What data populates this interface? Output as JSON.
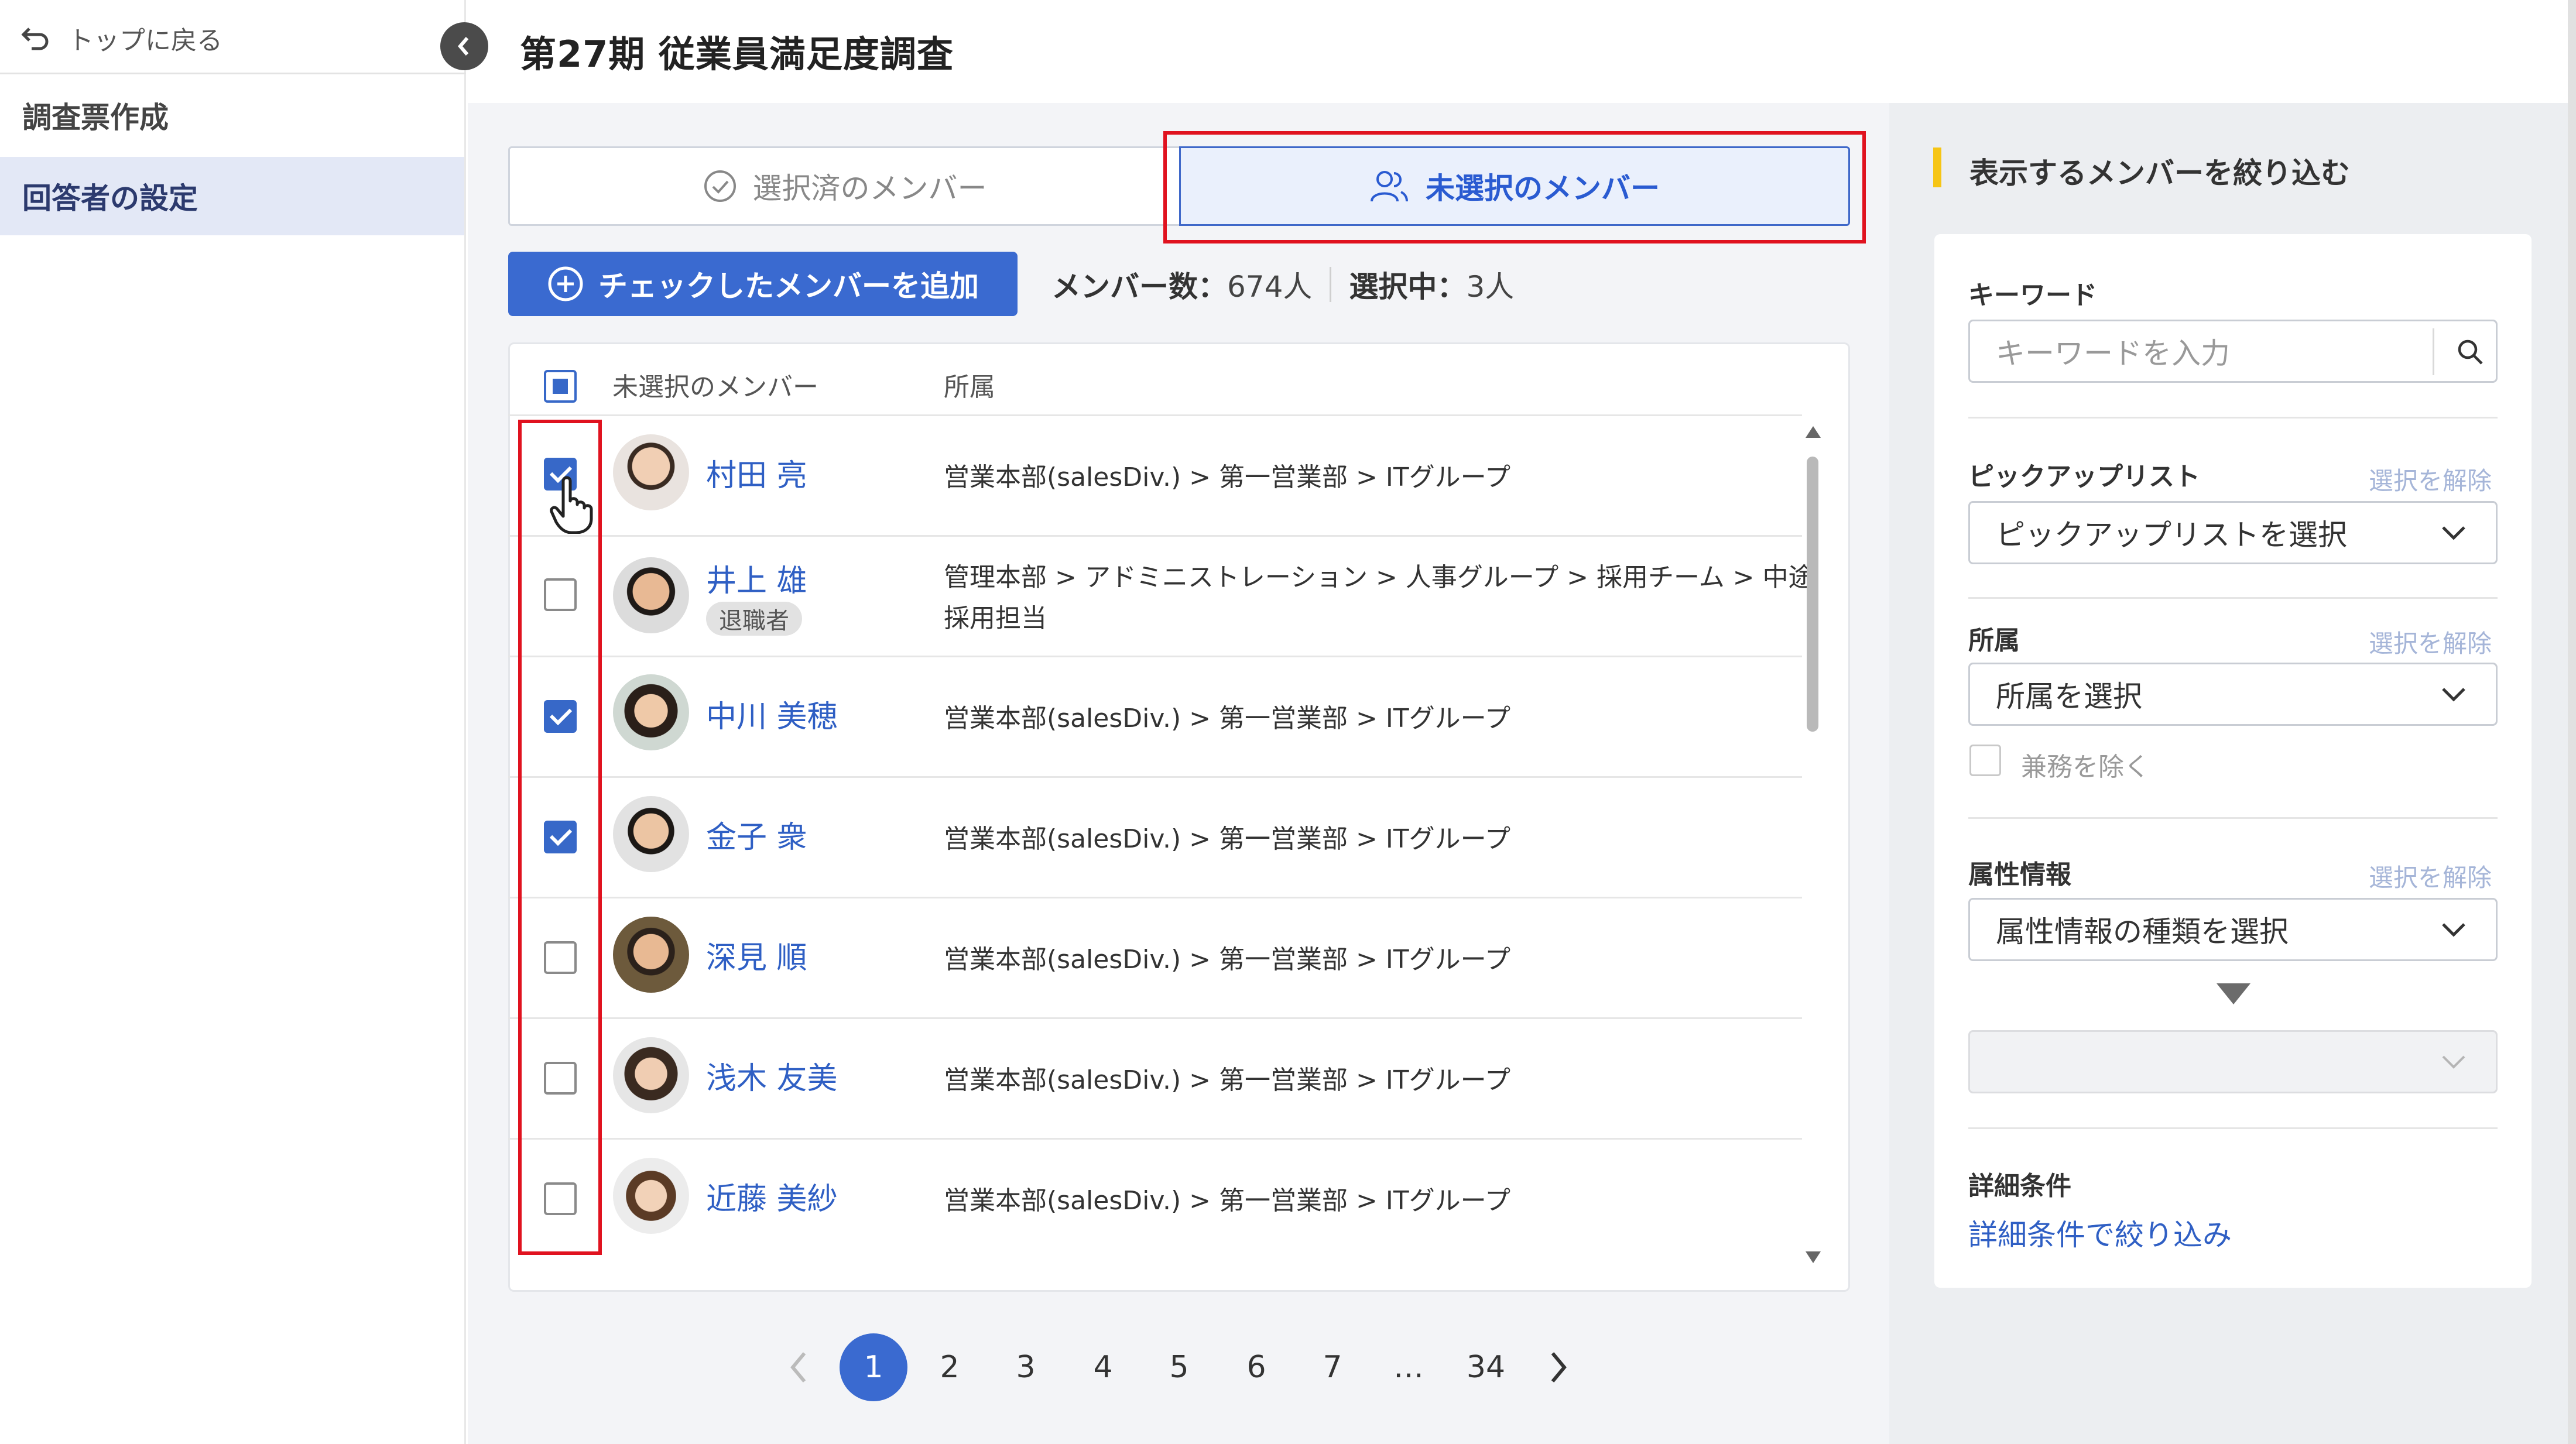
{
  "sidebar": {
    "back_label": "トップに戻る",
    "items": [
      {
        "label": "調査票作成"
      },
      {
        "label": "回答者の設定"
      }
    ]
  },
  "header": {
    "title": "第27期 従業員満足度調査"
  },
  "tabs": {
    "selected_label": "選択済のメンバー",
    "unselected_label": "未選択のメンバー"
  },
  "toolbar": {
    "add_label": "チェックしたメンバーを追加",
    "member_count_label": "メンバー数：",
    "member_count_value": "674人",
    "selected_label": "選択中：",
    "selected_value": "3人"
  },
  "table": {
    "columns": [
      "未選択のメンバー",
      "所属"
    ],
    "rows": [
      {
        "name": "村田 亮",
        "dept": "営業本部(salesDiv.) > 第一営業部 > ITグループ",
        "checked": true,
        "badge": ""
      },
      {
        "name": "井上 雄",
        "dept": "管理本部 > アドミニストレーション > 人事グループ > 採用チーム > 中途",
        "dept2": "採用担当",
        "checked": false,
        "badge": "退職者"
      },
      {
        "name": "中川 美穂",
        "dept": "営業本部(salesDiv.) > 第一営業部 > ITグループ",
        "checked": true,
        "badge": ""
      },
      {
        "name": "金子 衆",
        "dept": "営業本部(salesDiv.) > 第一営業部 > ITグループ",
        "checked": true,
        "badge": ""
      },
      {
        "name": "深見 順",
        "dept": "営業本部(salesDiv.) > 第一営業部 > ITグループ",
        "checked": false,
        "badge": ""
      },
      {
        "name": "浅木 友美",
        "dept": "営業本部(salesDiv.) > 第一営業部 > ITグループ",
        "checked": false,
        "badge": ""
      },
      {
        "name": "近藤 美紗",
        "dept": "営業本部(salesDiv.) > 第一営業部 > ITグループ",
        "checked": false,
        "badge": ""
      }
    ]
  },
  "pagination": {
    "pages": [
      "1",
      "2",
      "3",
      "4",
      "5",
      "6",
      "7",
      "…",
      "34"
    ],
    "current": "1"
  },
  "filter": {
    "title": "表示するメンバーを絞り込む",
    "keyword_label": "キーワード",
    "keyword_placeholder": "キーワードを入力",
    "pickup_label": "ピックアップリスト",
    "pickup_placeholder": "ピックアップリストを選択",
    "dept_label": "所属",
    "dept_placeholder": "所属を選択",
    "exclude_label": "兼務を除く",
    "attr_label": "属性情報",
    "attr_placeholder": "属性情報の種類を選択",
    "clear_label": "選択を解除",
    "detail_label": "詳細条件",
    "detail_link": "詳細条件で絞り込み"
  },
  "colors": {
    "accent": "#3a6ad0",
    "highlight": "#e0121f",
    "active_side": "#e3e8f6",
    "title_accent": "#f6c515"
  }
}
